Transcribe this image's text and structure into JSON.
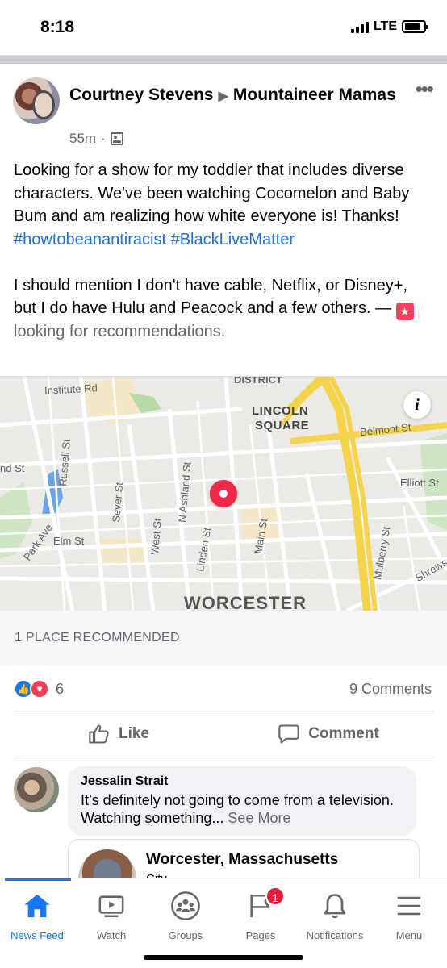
{
  "status_bar": {
    "time": "8:18",
    "network": "LTE"
  },
  "post": {
    "author": "Courtney Stevens",
    "group": "Mountaineer Mamas",
    "time_ago": "55m",
    "separator": "·",
    "body_line1": "Looking for a show for my toddler that includes diverse characters.  We've been watching Cocomelon and Baby Bum and am realizing how white everyone is! Thanks! ",
    "hashtag1": "#howtobeanantiracist",
    "hashtag2": "#BlackLiveMatter",
    "body_line2": "I should mention I don't have cable, Netflix, or Disney+, but I do have Hulu and Peacock and a few others. — ",
    "activity": "looking for recommendations.",
    "more_icon": "more-horizontal-icon"
  },
  "map": {
    "labels": {
      "district": "DISTRICT",
      "institute": "Institute Rd",
      "lincoln1": "LINCOLN",
      "lincoln2": "SQUARE",
      "belmont": "Belmont St",
      "elliott": "Elliott St",
      "nd_st": "nd St",
      "russell": "Russell St",
      "sever": "Sever St",
      "ashland": "N Ashland St",
      "park": "Park Ave",
      "elm": "Elm St",
      "west": "West St",
      "linden": "Linden St",
      "main": "Main St",
      "mulberry": "Mulberry St",
      "shrews": "Shrews",
      "city": "WORCESTER"
    },
    "info_label": "i",
    "places_recommended": "1 PLACE RECOMMENDED",
    "road_color": "#f5d34a",
    "pin_color": "#f0284a"
  },
  "reactions": {
    "count": "6",
    "comments": "9 Comments"
  },
  "actions": {
    "like": "Like",
    "comment": "Comment"
  },
  "comment": {
    "author": "Jessalin Strait",
    "text": "It’s definitely not going to come from a television. Watching something... ",
    "see_more": "See More",
    "link_title": "Worcester, Massachusetts",
    "link_sub": "City"
  },
  "tabs": [
    {
      "label": "News Feed",
      "icon": "home-icon"
    },
    {
      "label": "Watch",
      "icon": "watch-icon"
    },
    {
      "label": "Groups",
      "icon": "groups-icon"
    },
    {
      "label": "Pages",
      "icon": "pages-flag-icon",
      "badge": "1"
    },
    {
      "label": "Notifications",
      "icon": "bell-icon"
    },
    {
      "label": "Menu",
      "icon": "menu-icon"
    }
  ],
  "colors": {
    "accent": "#1877f2",
    "link": "#216fdb",
    "badge": "#e41e3f"
  }
}
